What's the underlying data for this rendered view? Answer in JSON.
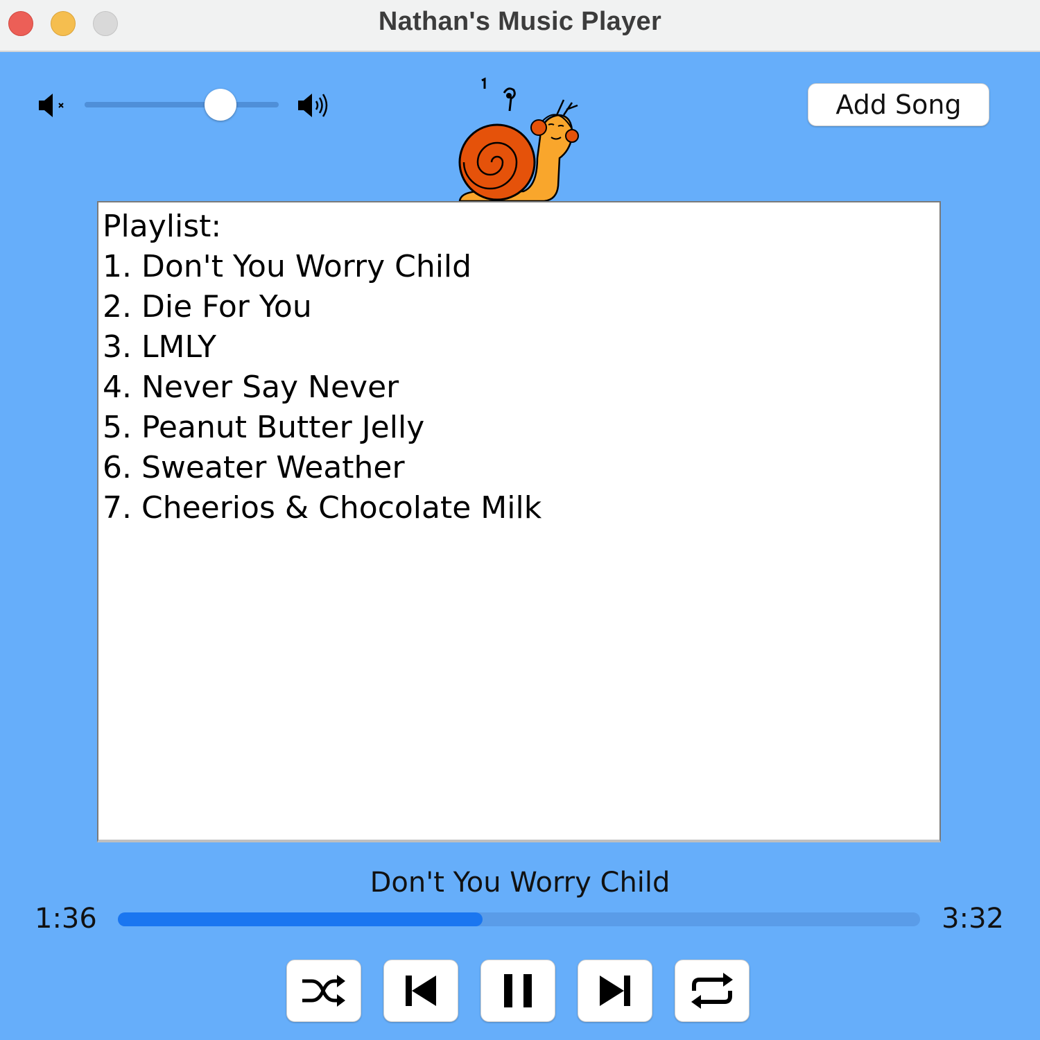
{
  "window": {
    "title": "Nathan's Music Player",
    "buttons": [
      "close",
      "minimize",
      "zoom"
    ]
  },
  "volume": {
    "level": 0.7,
    "min_icon": "speaker-muted-icon",
    "max_icon": "speaker-loud-icon"
  },
  "toolbar": {
    "add_song_label": "Add Song"
  },
  "mascot": {
    "icon": "snail-with-headphones-icon"
  },
  "playlist": {
    "header": "Playlist:",
    "items": [
      "1. Don't You Worry Child",
      "2. Die For You",
      "3. LMLY",
      "4. Never Say Never",
      "5. Peanut Butter Jelly",
      "6. Sweater Weather",
      "7. Cheerios & Chocolate Milk"
    ]
  },
  "now_playing": {
    "title": "Don't You Worry Child",
    "current_time": "1:36",
    "total_time": "3:32",
    "progress": 0.455
  },
  "controls": {
    "icons": [
      "shuffle-icon",
      "previous-icon",
      "pause-icon",
      "next-icon",
      "repeat-icon"
    ]
  },
  "colors": {
    "background": "#66AEFA",
    "progress_fill": "#1A76F0",
    "snail_shell": "#E5520A",
    "snail_body": "#F9A62C"
  }
}
